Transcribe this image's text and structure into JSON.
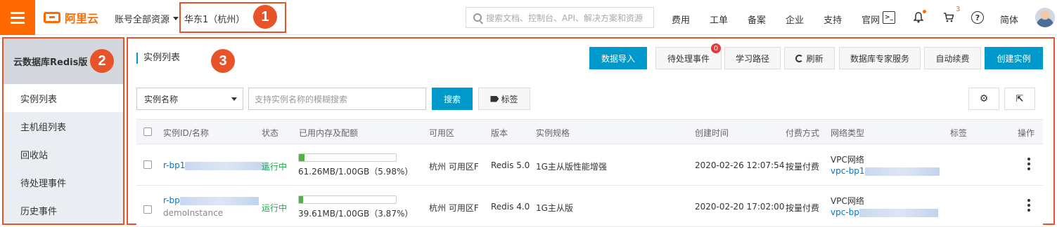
{
  "topbar": {
    "logo_text": "阿里云",
    "account_scope": "账号全部资源",
    "region": "华东1（杭州）",
    "search_placeholder": "搜索文档、控制台、API、解决方案和资源",
    "nav": [
      "费用",
      "工单",
      "备案",
      "企业",
      "支持",
      "官网"
    ],
    "cart_count": "3",
    "language": "简体"
  },
  "annotations": [
    "1",
    "2",
    "3"
  ],
  "sidebar": {
    "title": "云数据库Redis版",
    "items": [
      {
        "label": "实例列表",
        "active": true
      },
      {
        "label": "主机组列表"
      },
      {
        "label": "回收站"
      },
      {
        "label": "待处理事件"
      },
      {
        "label": "历史事件"
      }
    ]
  },
  "main": {
    "title": "实例列表",
    "toolbar": {
      "import": "数据导入",
      "pending": "待处理事件",
      "pending_count": "0",
      "learn": "学习路径",
      "refresh": "刷新",
      "expert": "数据库专家服务",
      "autorenew": "自动续费",
      "create": "创建实例"
    },
    "filter": {
      "field": "实例名称",
      "placeholder": "支持实例名称的模糊搜索",
      "search": "搜索",
      "tag": "标签"
    },
    "table": {
      "columns": [
        "实例ID/名称",
        "状态",
        "已用内存及配额",
        "可用区",
        "版本",
        "实例规格",
        "创建时间",
        "付费方式",
        "网络类型",
        "标签",
        "操作"
      ],
      "rows": [
        {
          "id_prefix": "r-bp1",
          "name": "",
          "status": "运行中",
          "memory": "61.26MB/1.00GB（5.98%）",
          "usage_pct": 5.98,
          "zone": "杭州 可用区F",
          "version": "Redis 5.0",
          "spec": "1G主从版性能增强",
          "created": "2020-02-26 12:07:54",
          "billing": "按量付费",
          "network": "VPC网络",
          "vpc_prefix": "vpc-bp1"
        },
        {
          "id_prefix": "r-bp",
          "name": "demoInstance",
          "status": "运行中",
          "memory": "39.61MB/1.00GB（3.87%）",
          "usage_pct": 3.87,
          "zone": "杭州 可用区F",
          "version": "Redis 4.0",
          "spec": "1G主从版",
          "created": "2020-02-20 17:02:00",
          "billing": "按量付费",
          "network": "VPC网络",
          "vpc_prefix": "vpc-bp"
        }
      ]
    }
  },
  "colors": {
    "brand": "#ff6a00",
    "primary": "#0099cc",
    "annotation": "#e8542a",
    "running": "#1aa94c"
  }
}
